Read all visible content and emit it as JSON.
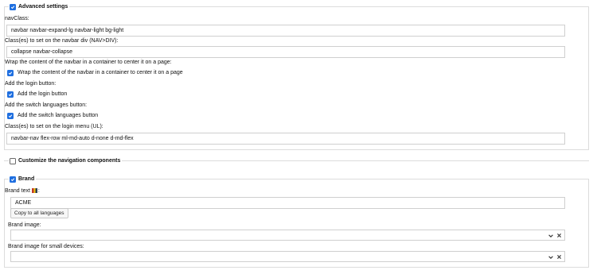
{
  "advanced": {
    "legend": "Advanced settings",
    "navclass_label": "navClass:",
    "navclass_value": "navbar navbar-expand-lg navbar-light bg-light",
    "navdiv_label": "Class(es) to set on the navbar div (NAV>DIV):",
    "navdiv_value": "collapse navbar-collapse",
    "wrap_label": "Wrap the content of the navbar in a container to center it on a page:",
    "wrap_checkbox": "Wrap the content of the navbar in a container to center it on a page",
    "login_label": "Add the login button:",
    "login_checkbox": "Add the login button",
    "switch_label": "Add the switch languages button:",
    "switch_checkbox": "Add the switch languages button",
    "loginmenu_label": "Class(es) to set on the login menu (UL):",
    "loginmenu_value": "navbar-nav flex-row ml-md-auto d-none d-md-flex"
  },
  "customize": {
    "legend": "Customize the navigation components"
  },
  "brand": {
    "legend": "Brand",
    "text_label": "Brand text",
    "text_label_suffix": ":",
    "text_value": "ACME",
    "copy_button": "Copy to all languages",
    "image_label": "Brand image:",
    "image_small_label": "Brand image for small devices:"
  },
  "colors": {
    "accent": "#1f6fe0",
    "border": "#dcdcdc"
  }
}
